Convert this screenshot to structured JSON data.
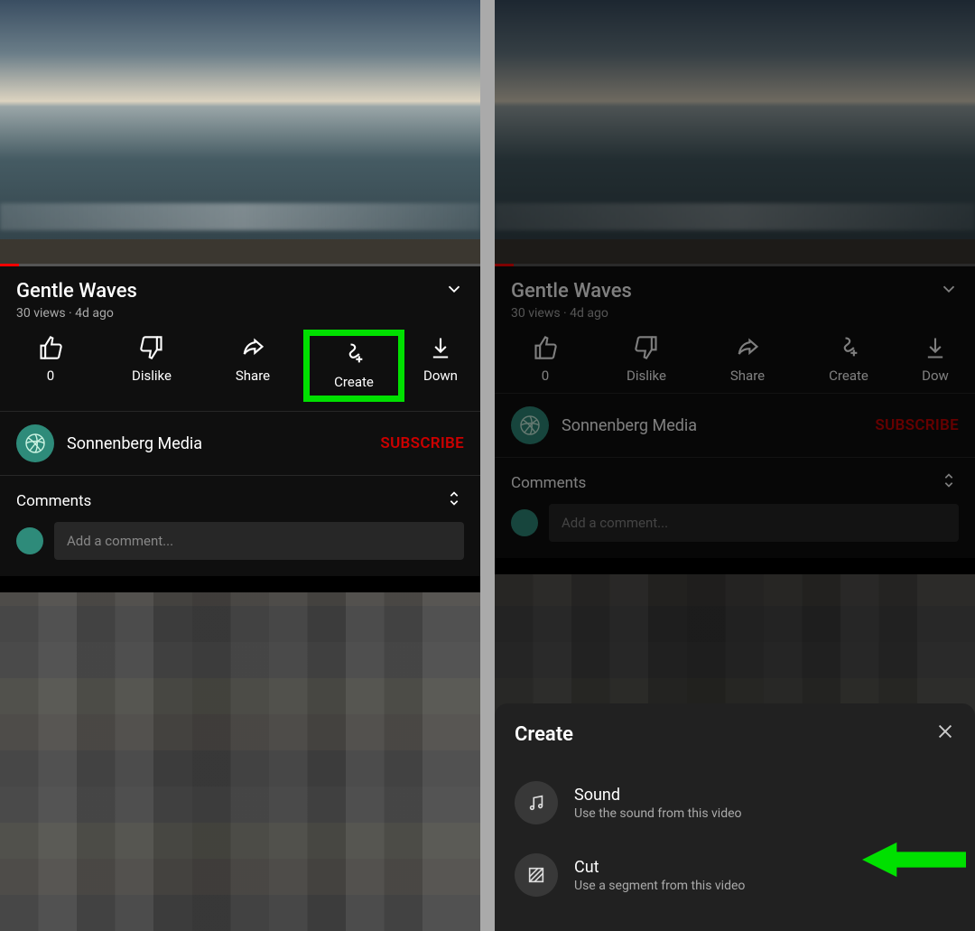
{
  "left": {
    "video": {
      "title": "Gentle Waves",
      "stats": "30 views · 4d ago",
      "progress_pct": 4
    },
    "actions": {
      "like_count": "0",
      "dislike_label": "Dislike",
      "share_label": "Share",
      "create_label": "Create",
      "download_label": "Down"
    },
    "channel": {
      "name": "Sonnenberg Media",
      "subscribe_label": "SUBSCRIBE"
    },
    "comments": {
      "header": "Comments",
      "placeholder": "Add a comment..."
    },
    "highlight": "create"
  },
  "right": {
    "video": {
      "title": "Gentle Waves",
      "stats": "30 views · 4d ago",
      "progress_pct": 4
    },
    "actions": {
      "like_count": "0",
      "dislike_label": "Dislike",
      "share_label": "Share",
      "create_label": "Create",
      "download_label": "Dow"
    },
    "channel": {
      "name": "Sonnenberg Media",
      "subscribe_label": "SUBSCRIBE"
    },
    "comments": {
      "header": "Comments",
      "placeholder": "Add a comment..."
    },
    "sheet": {
      "title": "Create",
      "items": [
        {
          "title": "Sound",
          "sub": "Use the sound from this video"
        },
        {
          "title": "Cut",
          "sub": "Use a segment from this video"
        }
      ]
    },
    "arrow_target": "cut"
  },
  "colors": {
    "highlight": "#00e000",
    "subscribe": "#cc0000"
  }
}
